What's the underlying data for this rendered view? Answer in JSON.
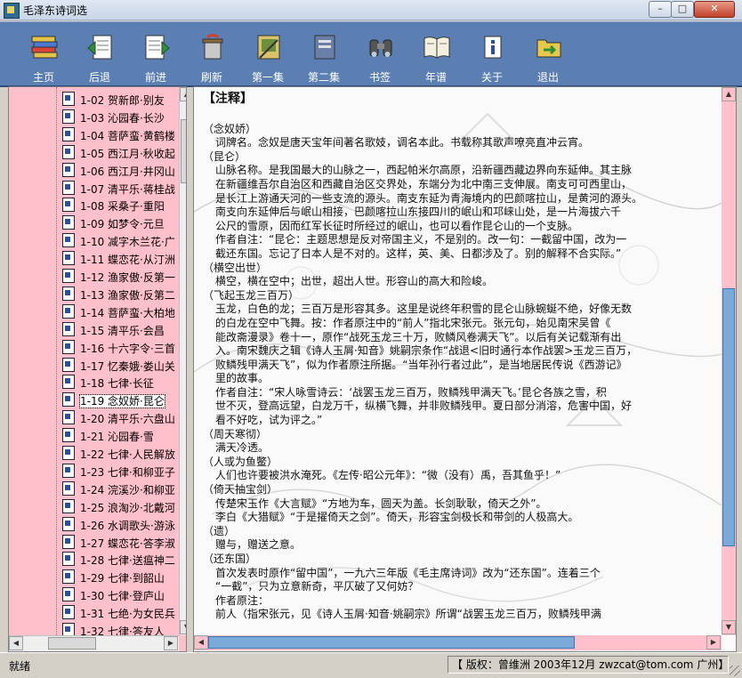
{
  "window": {
    "title": "毛泽东诗词选",
    "minimize": "–",
    "maximize": "□",
    "close": "✕"
  },
  "toolbar": [
    {
      "label": "主页",
      "icon": "books-icon"
    },
    {
      "label": "后退",
      "icon": "back-doc-icon"
    },
    {
      "label": "前进",
      "icon": "forward-doc-icon"
    },
    {
      "label": "刷新",
      "icon": "refresh-icon"
    },
    {
      "label": "第一集",
      "icon": "volume-one-icon"
    },
    {
      "label": "第二集",
      "icon": "volume-two-icon"
    },
    {
      "label": "书签",
      "icon": "binoculars-icon"
    },
    {
      "label": "年谱",
      "icon": "open-book-icon"
    },
    {
      "label": "关于",
      "icon": "info-icon"
    },
    {
      "label": "退出",
      "icon": "exit-folder-icon"
    }
  ],
  "tree": {
    "items": [
      "1-02 贺新郎·别友",
      "1-03 沁园春·长沙",
      "1-04 菩萨蛮·黄鹤楼",
      "1-05 西江月·秋收起",
      "1-06 西江月·井冈山",
      "1-07 清平乐·蒋桂战",
      "1-08 采桑子·重阳",
      "1-09 如梦令·元旦",
      "1-10 减字木兰花·广",
      "1-11 蝶恋花·从汀洲",
      "1-12 渔家傲·反第一",
      "1-13 渔家傲·反第二",
      "1-14 菩萨蛮·大柏地",
      "1-15 清平乐·会昌",
      "1-16 十六字令·三首",
      "1-17 忆秦娥·娄山关",
      "1-18 七律·长征",
      "1-19 念奴娇·昆仑",
      "1-20 清平乐·六盘山",
      "1-21 沁园春·雪",
      "1-22 七律·人民解放",
      "1-23 七律·和柳亚子",
      "1-24 浣溪沙·和柳亚",
      "1-25 浪淘沙·北戴河",
      "1-26 水调歌头·游泳",
      "1-27 蝶恋花·答李淑",
      "1-28 七律·送瘟神二",
      "1-29 七律·到韶山",
      "1-30 七律·登庐山",
      "1-31 七绝·为女民兵",
      "1-32 七律·答友人"
    ],
    "selected_index": 17
  },
  "content": {
    "title": "【注释】",
    "entries": [
      {
        "head": "（念奴娇）",
        "body": "词牌名。念奴是唐天宝年间著名歌妓，调名本此。书载称其歌声嘹亮直冲云宵。"
      },
      {
        "head": "（昆仑）",
        "body": "山脉名称。是我国最大的山脉之一，西起帕米尔高原，沿新疆西藏边界向东延伸。其主脉\n在新疆维吾尔自治区和西藏自治区交界处，东端分为北中南三支伸展。南支可可西里山，\n是长江上游通天河的一些支流的源头。南支东延为青海境内的巴颜喀拉山，是黄河的源头。\n南支向东延伸后与岷山相接，巴颜喀拉山东接四川的岷山和邛崃山处，是一片海拔六千\n公尺的雪原，因而红军长征时所经过的岷山，也可以看作昆仑山的一个支脉。\n作者自注：“昆仑：主题思想是反对帝国主义，不是别的。改一句：一截留中国，改为一\n截还东国。忘记了日本人是不对的。这样，英、美、日都涉及了。别的解释不合实际。”"
      },
      {
        "head": "（横空出世）",
        "body": "横空，横在空中；出世，超出人世。形容山的高大和险峻。"
      },
      {
        "head": "（飞起玉龙三百万）",
        "body": "玉龙，白色的龙；三百万是形容其多。这里是说终年积雪的昆仑山脉蜿蜒不绝，好像无数\n的白龙在空中飞舞。按：作者原注中的“前人”指北宋张元。张元句，始见南宋吴曾《\n能改斋漫录》卷十一，原作“战死玉龙三十万，败鳞风卷满天飞”。以后有关记载渐有出\n入。南宋魏庆之辑《诗人玉屑·知音》姚嗣宗条作“战退&lt;旧时通行本作战罢&gt;玉龙三百万，\n败鳞残甲满天飞”，似为作者原注所据。“当年孙行者过此”，是当地居民传说《西游记》\n里的故事。\n作者自注：“宋人咏雪诗云：‘战罢玉龙三百万，败鳞残甲满天飞。’昆仑各族之雪，积\n世不灭，登高远望，白龙万千，纵横飞舞，并非败鳞残甲。夏日部分消溶，危害中国，好\n看不好吃，试为评之。”"
      },
      {
        "head": "（周天寒彻）",
        "body": "满天冷透。"
      },
      {
        "head": "（人或为鱼鳖）",
        "body": "人们也许要被洪水淹死。《左传·昭公元年》：“微（没有）禹，吾其鱼乎！”"
      },
      {
        "head": "（倚天抽宝剑）",
        "body": "传楚宋玉作《大言赋》“方地为车，圆天为盖。长剑耿耿，倚天之外”。\n李白《大猎赋》“于是擢倚天之剑”。倚天，形容宝剑极长和带剑的人极高大。"
      },
      {
        "head": "（遗）",
        "body": "赠与，赠送之意。"
      },
      {
        "head": "（还东国）",
        "body": "首次发表时原作“留中国”，一九六三年版《毛主席诗词》改为“还东国”。连着三个\n“一截”，只为立意新奇，平仄破了又何妨？\n作者原注：\n前人（指宋张元，见《诗人玉屑·知音·姚嗣宗》所谓“战罢玉龙三百万，败鳞残甲满"
      }
    ]
  },
  "status": {
    "left": "就绪",
    "right": "【 版权：曾维洲 2003年12月 zwzcat@tom.com 广州】"
  },
  "colors": {
    "toolbar_bg": "#5c7fb3",
    "tree_bg": "#ffc0cb",
    "scrollbar_pink": "#ffc0cb"
  }
}
